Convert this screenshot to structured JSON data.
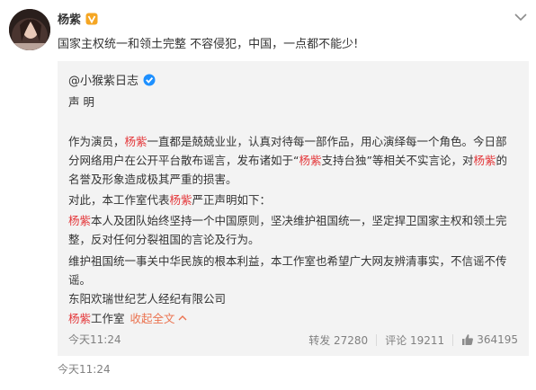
{
  "post": {
    "author": "杨紫",
    "text": "国家主权统一和领土完整 不容侵犯，中国，一点都不能少!",
    "time": "今天11:24"
  },
  "repost": {
    "author": "@小猴紫日志",
    "title": "声 明",
    "p1_a": "作为演员，",
    "p1_name": "杨紫",
    "p1_b": "一直都是兢兢业业，认真对待每一部作品，用心演绎每一个角色。今日部分网络用户在公开平台散布谣言，发布诸如于“",
    "p1_name2": "杨紫",
    "p1_c": "支持台独”等相关不实言论，对",
    "p1_name3": "杨紫",
    "p1_d": "的名誉及形象造成极其严重的损害。",
    "p2_a": "对此，本工作室代表",
    "p2_name": "杨紫",
    "p2_b": "严正声明如下：",
    "p3_name": "杨紫",
    "p3_b": "本人及团队始终坚持一个中国原则，坚决维护祖国统一，坚定捍卫国家主权和领土完整，反对任何分裂祖国的言论及行为。",
    "p4": "维护祖国统一事关中华民族的根本利益，本工作室也希望广大网友辨清事实，不信谣不传谣。",
    "company": "东阳欢瑞世纪艺人经纪有限公司",
    "studio_name": "杨紫",
    "studio_suffix": "工作室",
    "collapse_label": "收起全文",
    "time": "今天11:24",
    "repost_label": "转发 27280",
    "comment_label": "评论 19211",
    "like_count": "364195"
  },
  "colors": {
    "accent": "#eb7350",
    "vip": "#f5a623",
    "verified": "#1e90ff",
    "muted": "#808080",
    "repost_bg": "#f3f3f3"
  },
  "icons": {
    "menu": "chevron-down-icon",
    "vip": "vip-badge-icon",
    "verified": "verified-badge-icon",
    "collapse": "chevron-up-icon",
    "like": "thumbs-up-icon"
  }
}
